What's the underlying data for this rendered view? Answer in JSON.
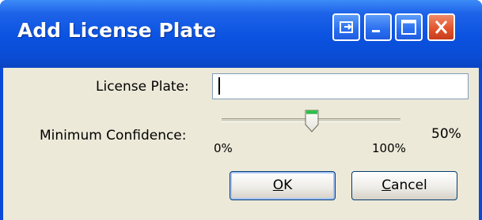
{
  "window": {
    "title": "Add License Plate",
    "colors": {
      "titlebar": "#0a52e0",
      "client": "#ece9d8",
      "close": "#e2542c"
    }
  },
  "titlebar_buttons": {
    "restore_icon": "restore-window-icon",
    "minimize_icon": "minimize-icon",
    "maximize_icon": "maximize-icon",
    "close_icon": "close-icon"
  },
  "form": {
    "plate_label": "License Plate:",
    "plate_value": "",
    "confidence_label": "Minimum Confidence:",
    "slider": {
      "value_percent": 50,
      "min_label": "0%",
      "max_label": "100%",
      "value_label": "50%"
    }
  },
  "buttons": {
    "ok": {
      "accel": "O",
      "rest": "K"
    },
    "cancel": {
      "accel": "C",
      "rest": "ancel"
    }
  }
}
